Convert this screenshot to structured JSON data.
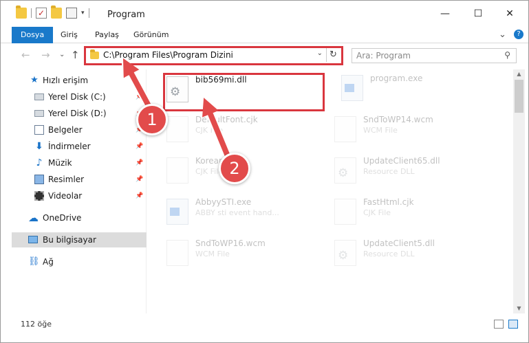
{
  "window": {
    "title": "Program",
    "minimize_glyph": "—",
    "maximize_glyph": "☐",
    "close_glyph": "✕"
  },
  "ribbon": {
    "tabs": [
      "Dosya",
      "Giriş",
      "Paylaş",
      "Görünüm"
    ],
    "expand_glyph": "⌄",
    "help_glyph": "?"
  },
  "nav": {
    "back_glyph": "←",
    "forward_glyph": "→",
    "recent_glyph": "⌄",
    "up_glyph": "↑",
    "address": "C:\\Program Files\\Program Dizini",
    "address_dropdown_glyph": "⌄",
    "refresh_glyph": "↻",
    "search_placeholder": "Ara: Program",
    "search_glyph": "⚲"
  },
  "sidebar": {
    "items": [
      {
        "label": "Hızlı erişim",
        "icon": "star-icon",
        "glyph": "★",
        "pinned": false
      },
      {
        "label": "Yerel Disk (C:)",
        "icon": "drive-icon",
        "pinned": true
      },
      {
        "label": "Yerel Disk (D:)",
        "icon": "drive-icon",
        "pinned": true
      },
      {
        "label": "Belgeler",
        "icon": "documents-icon",
        "pinned": true
      },
      {
        "label": "İndirmeler",
        "icon": "downloads-icon",
        "glyph": "⬇",
        "pinned": true
      },
      {
        "label": "Müzik",
        "icon": "music-icon",
        "glyph": "♪",
        "pinned": true
      },
      {
        "label": "Resimler",
        "icon": "pictures-icon",
        "pinned": true
      },
      {
        "label": "Videolar",
        "icon": "videos-icon",
        "pinned": true
      },
      {
        "label": "OneDrive",
        "icon": "cloud-icon",
        "glyph": "☁",
        "pinned": false
      },
      {
        "label": "Bu bilgisayar",
        "icon": "computer-icon",
        "pinned": false,
        "selected": true
      },
      {
        "label": "Ağ",
        "icon": "network-icon",
        "glyph": "⛓",
        "pinned": false
      }
    ],
    "pin_glyph": "📌"
  },
  "files": [
    {
      "name": "bib569mi.dll",
      "type": "",
      "icon": "dll-gear-icon",
      "highlighted": true
    },
    {
      "name": "program.exe",
      "type": "",
      "icon": "exe-icon",
      "highlighted": false
    },
    {
      "name": "DefaultFont.cjk",
      "type": "CJK File",
      "icon": "file-icon",
      "highlighted": false
    },
    {
      "name": "SndToWP14.wcm",
      "type": "WCM File",
      "icon": "file-icon",
      "highlighted": false
    },
    {
      "name": "Korean.cjk",
      "type": "CJK File",
      "icon": "file-icon",
      "highlighted": false
    },
    {
      "name": "UpdateClient65.dll",
      "type": "Resource DLL",
      "icon": "dll-gear-icon",
      "highlighted": false
    },
    {
      "name": "AbbyySTI.exe",
      "type": "ABBY sti event hand...",
      "icon": "exe-icon",
      "highlighted": false
    },
    {
      "name": "FastHtml.cjk",
      "type": "CJK File",
      "icon": "file-icon",
      "highlighted": false
    },
    {
      "name": "SndToWP16.wcm",
      "type": "WCM File",
      "icon": "file-icon",
      "highlighted": false
    },
    {
      "name": "UpdateClient5.dll",
      "type": "Resource DLL",
      "icon": "dll-gear-icon",
      "highlighted": false
    }
  ],
  "status": {
    "item_count": "112 öğe"
  },
  "annotations": {
    "badge1": "1",
    "badge2": "2",
    "color": "#e24b4b"
  }
}
